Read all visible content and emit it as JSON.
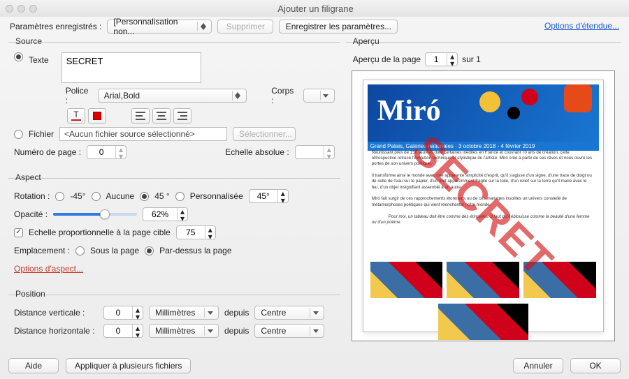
{
  "title": "Ajouter un filigrane",
  "toprow": {
    "params_label": "Paramètres enregistrés :",
    "preset_value": "[Personnalisation non...",
    "delete_btn": "Supprimer",
    "save_params_btn": "Enregistrer les paramètres...",
    "options_etendue": "Options d'étendue..."
  },
  "source": {
    "title": "Source",
    "texte_radio": "Texte",
    "texte_value": "SECRET",
    "police_label": "Police :",
    "police_value": "Arial,Bold",
    "corps_label": "Corps :",
    "fichier_radio": "Fichier",
    "fichier_value": "<Aucun fichier source sélectionné>",
    "select_btn": "Sélectionner...",
    "numero_page_label": "Numéro de page :",
    "numero_page_value": "0",
    "echelle_abs_label": "Echelle absolue :"
  },
  "aspect": {
    "title": "Aspect",
    "rotation_label": "Rotation :",
    "rot_m45": "-45°",
    "rot_none": "Aucune",
    "rot_45": "45 °",
    "rot_custom": "Personnalisée",
    "rot_custom_val": "45°",
    "opacite_label": "Opacité :",
    "opacite_value": "62%",
    "opacite_ratio": 0.62,
    "echelle_prop": "Echelle proportionnelle à la page cible",
    "echelle_prop_val": "75",
    "emplacement_label": "Emplacement :",
    "sous": "Sous la page",
    "dessus": "Par-dessus la page",
    "options_aspect": "Options d'aspect..."
  },
  "position": {
    "title": "Position",
    "dist_v_label": "Distance verticale :",
    "dist_v_val": "0",
    "dist_h_label": "Distance horizontale :",
    "dist_h_val": "0",
    "unit": "Millimètres",
    "depuis": "depuis",
    "centre": "Centre"
  },
  "apercu": {
    "title": "Aperçu",
    "apercu_page": "Aperçu de la page",
    "page_val": "1",
    "sur": "sur 1",
    "miro_title": "Miró",
    "miro_sub": "Grand Palais, Galeries nationales · 3 octobre 2018 - 4 février 2019",
    "watermark": "SECRET"
  },
  "footer": {
    "aide": "Aide",
    "apply_multi": "Appliquer à plusieurs fichiers",
    "annuler": "Annuler",
    "ok": "OK"
  }
}
